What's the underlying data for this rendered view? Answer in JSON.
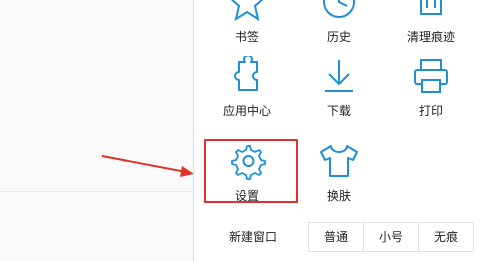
{
  "menu": {
    "row1": [
      {
        "label": "书签",
        "icon": "bookmark-star-icon"
      },
      {
        "label": "历史",
        "icon": "history-icon"
      },
      {
        "label": "清理痕迹",
        "icon": "clean-icon"
      }
    ],
    "row2": [
      {
        "label": "应用中心",
        "icon": "puzzle-icon"
      },
      {
        "label": "下载",
        "icon": "download-icon"
      },
      {
        "label": "打印",
        "icon": "printer-icon"
      }
    ],
    "row3": [
      {
        "label": "设置",
        "icon": "gear-icon"
      },
      {
        "label": "换肤",
        "icon": "tshirt-icon"
      }
    ]
  },
  "bottom": {
    "new_window": "新建窗口",
    "zoom": [
      "普通",
      "小号",
      "无痕"
    ]
  },
  "colors": {
    "icon": "#1f8fd6",
    "highlight": "#e0322c",
    "arrow": "#e0322c"
  }
}
